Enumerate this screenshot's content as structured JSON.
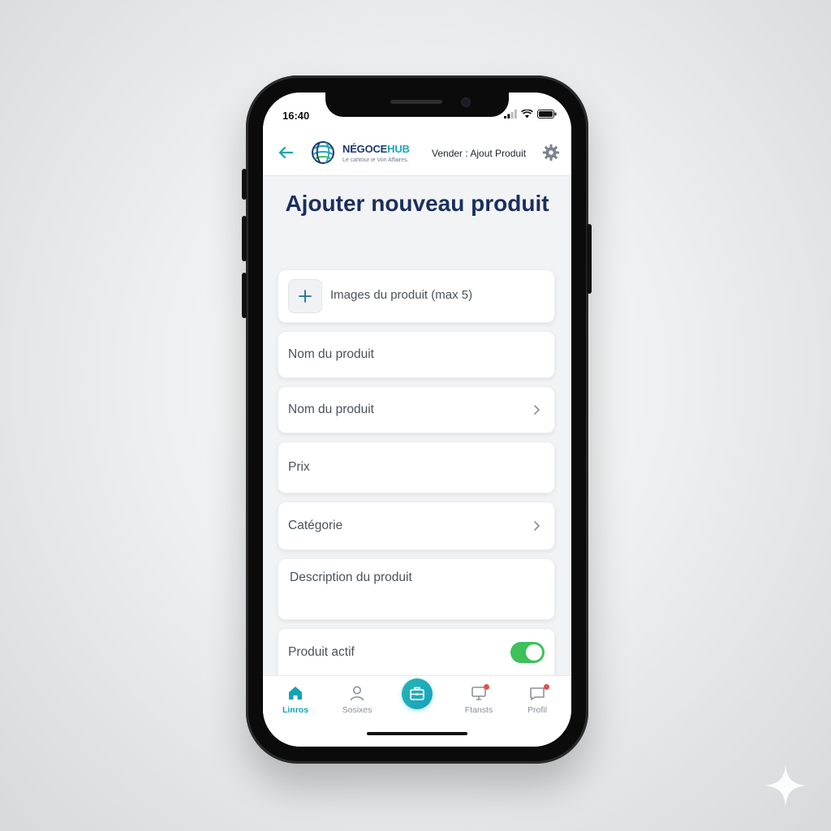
{
  "status_bar": {
    "time": "16:40"
  },
  "header": {
    "brand_prefix": "NÉGOCE",
    "brand_suffix": "HUB",
    "tagline": "Le cahtour ie Von Affaires.",
    "title": "Vender : Ajout Produit"
  },
  "page": {
    "title": "Ajouter nouveau produit"
  },
  "form": {
    "images_label": "Images du produit (max 5)",
    "field_1": "Nom du produit",
    "field_2": "Nom du produit",
    "price": "Prix",
    "category": "Catégorie",
    "description": "Description du produit",
    "active_label": "Produit actif",
    "active_on": true
  },
  "tabbar": {
    "tabs": [
      {
        "label": "Linros",
        "icon": "home-icon",
        "active": true
      },
      {
        "label": "Sosixes",
        "icon": "person-icon",
        "active": false
      },
      {
        "label": "",
        "icon": "briefcase-icon",
        "active": false
      },
      {
        "label": "Ftansts",
        "icon": "monitor-icon",
        "active": false
      },
      {
        "label": "Profil",
        "icon": "message-icon",
        "active": false
      }
    ]
  },
  "colors": {
    "accent": "#12a3b4",
    "title": "#1b2f5e",
    "toggle_on": "#3ec05a",
    "badge": "#e0524c"
  }
}
